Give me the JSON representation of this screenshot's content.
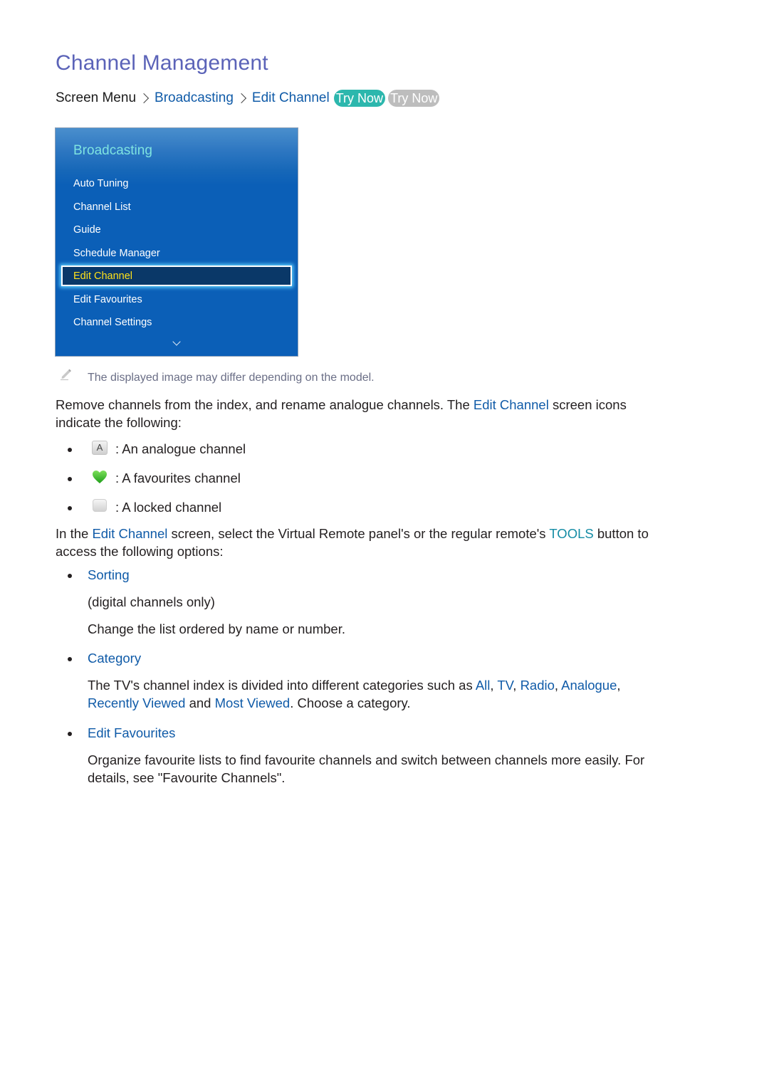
{
  "page": {
    "title": "Channel Management"
  },
  "breadcrumb": {
    "root": "Screen Menu",
    "items": [
      "Broadcasting",
      "Edit Channel"
    ],
    "try_now_1": "Try Now",
    "try_now_2": "Try Now"
  },
  "menu": {
    "header": "Broadcasting",
    "items": [
      {
        "label": "Auto Tuning"
      },
      {
        "label": "Channel List"
      },
      {
        "label": "Guide"
      },
      {
        "label": "Schedule Manager"
      },
      {
        "label": "Edit Channel",
        "selected": true
      },
      {
        "label": "Edit Favourites"
      },
      {
        "label": "Channel Settings"
      }
    ],
    "more_icon": "chevron-down-icon"
  },
  "note": {
    "icon": "pencil-icon",
    "text": "The displayed image may differ depending on the model."
  },
  "intro": {
    "part1": "Remove channels from the index, and rename analogue channels. The ",
    "link": "Edit Channel",
    "part2": " screen icons",
    "line2": "indicate the following:"
  },
  "icon_legend": [
    {
      "icon": "analogue-icon",
      "glyph": "A",
      "text": ": An analogue channel"
    },
    {
      "icon": "heart-icon",
      "text": ": A favourites channel"
    },
    {
      "icon": "lock-icon",
      "text": ": A locked channel"
    }
  ],
  "tools_para": {
    "part1": "In the ",
    "link1": "Edit Channel",
    "part2": " screen, select the Virtual Remote panel's or the regular remote's ",
    "link2": "TOOLS",
    "part3": " button to",
    "line2": "access the following options:"
  },
  "options": {
    "sorting": {
      "title": "Sorting",
      "line1": "(digital channels only)",
      "line2": "Change the list ordered by name or number."
    },
    "category": {
      "title": "Category",
      "text1": "The TV's channel index is divided into different categories such as ",
      "c_all": "All",
      "c_tv": "TV",
      "c_radio": "Radio",
      "c_analogue": "Analogue",
      "c_recent": "Recently Viewed",
      "and": " and ",
      "c_most": "Most Viewed",
      "text2": ". Choose a category.",
      "comma": ", "
    },
    "favourites": {
      "title": "Edit Favourites",
      "line1": "Organize favourite lists to find favourite channels and switch between channels more easily. For",
      "line2": "details, see \"Favourite Channels\"."
    }
  },
  "colors": {
    "title": "#5b63b8",
    "link": "#105ba8",
    "tools": "#148ca5",
    "try_now_active": "#2cb7ad",
    "try_now_inactive": "#bdbdbd",
    "menu_bg": "#0b5fb7",
    "menu_header": "#7ee3e0",
    "menu_selected_text": "#ffe21a"
  }
}
